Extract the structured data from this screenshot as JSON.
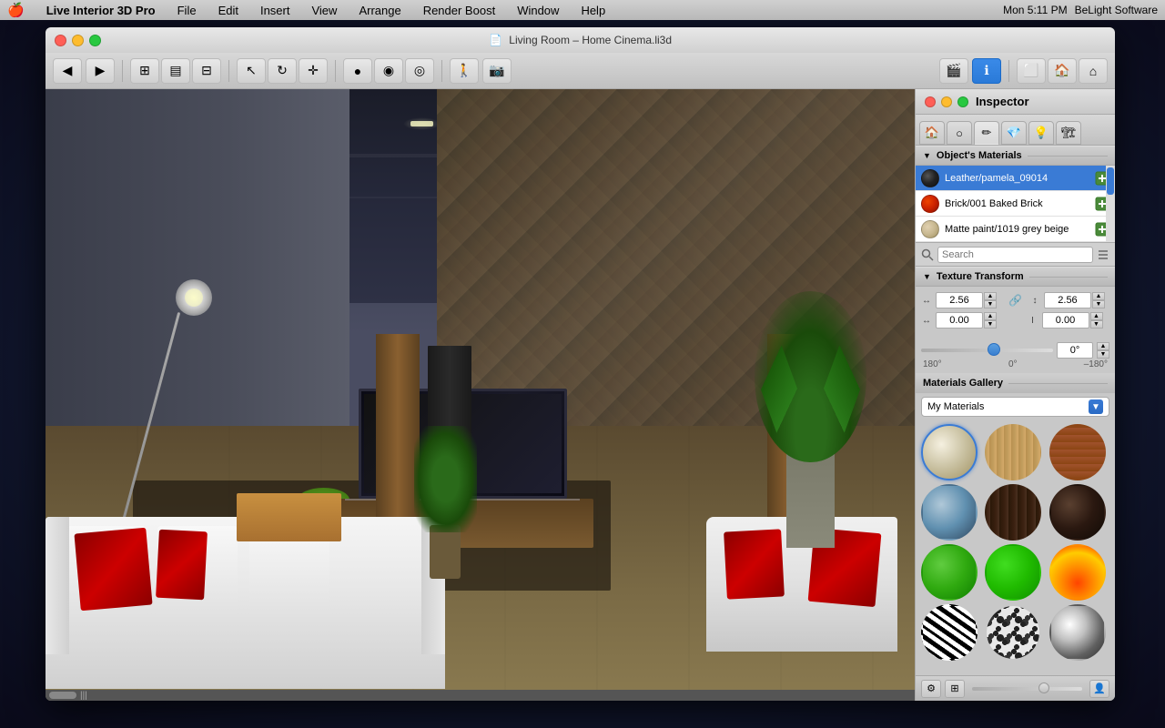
{
  "menubar": {
    "apple": "🍎",
    "items": [
      "Live Interior 3D Pro",
      "File",
      "Edit",
      "Insert",
      "View",
      "Arrange",
      "Render Boost",
      "Window",
      "Help"
    ],
    "right": {
      "time": "Mon 5:11 PM",
      "brand": "BeLight Software"
    }
  },
  "window": {
    "title": "Living Room – Home Cinema.li3d",
    "controls": {
      "close": "close",
      "minimize": "minimize",
      "maximize": "maximize"
    }
  },
  "inspector": {
    "title": "Inspector",
    "section_materials": "Object's Materials",
    "materials": [
      {
        "name": "Leather/pamela_09014",
        "color": "#3a3a3a",
        "selected": true
      },
      {
        "name": "Brick/001 Baked Brick",
        "color": "#cc3300",
        "selected": false
      },
      {
        "name": "Matte paint/1019 grey beige",
        "color": "#c8b898",
        "selected": false
      }
    ],
    "texture_transform": {
      "label": "Texture Transform",
      "width_val": "2.56",
      "height_val": "2.56",
      "offset_x": "0.00",
      "offset_y": "0.00",
      "rotation_val": "0°",
      "rotation_left": "180°",
      "rotation_center": "0°",
      "rotation_right": "–180°"
    },
    "gallery": {
      "label": "Materials Gallery",
      "dropdown_label": "My Materials",
      "materials": [
        {
          "id": "ivory",
          "class": "mb-ivory"
        },
        {
          "id": "wood-light",
          "class": "mb-wood-light"
        },
        {
          "id": "brick",
          "class": "mb-brick"
        },
        {
          "id": "water",
          "class": "mb-water"
        },
        {
          "id": "dark-wood",
          "class": "mb-dark-wood"
        },
        {
          "id": "dark-sphere",
          "class": "mb-dark-sphere"
        },
        {
          "id": "green",
          "class": "mb-green"
        },
        {
          "id": "green2",
          "class": "mb-green2"
        },
        {
          "id": "fire",
          "class": "mb-fire"
        },
        {
          "id": "zebra",
          "class": "mb-zebra"
        },
        {
          "id": "spots",
          "class": "mb-spots"
        },
        {
          "id": "chrome",
          "class": "mb-chrome"
        }
      ]
    }
  },
  "toolbar": {
    "back_label": "◀",
    "forward_label": "▶"
  }
}
